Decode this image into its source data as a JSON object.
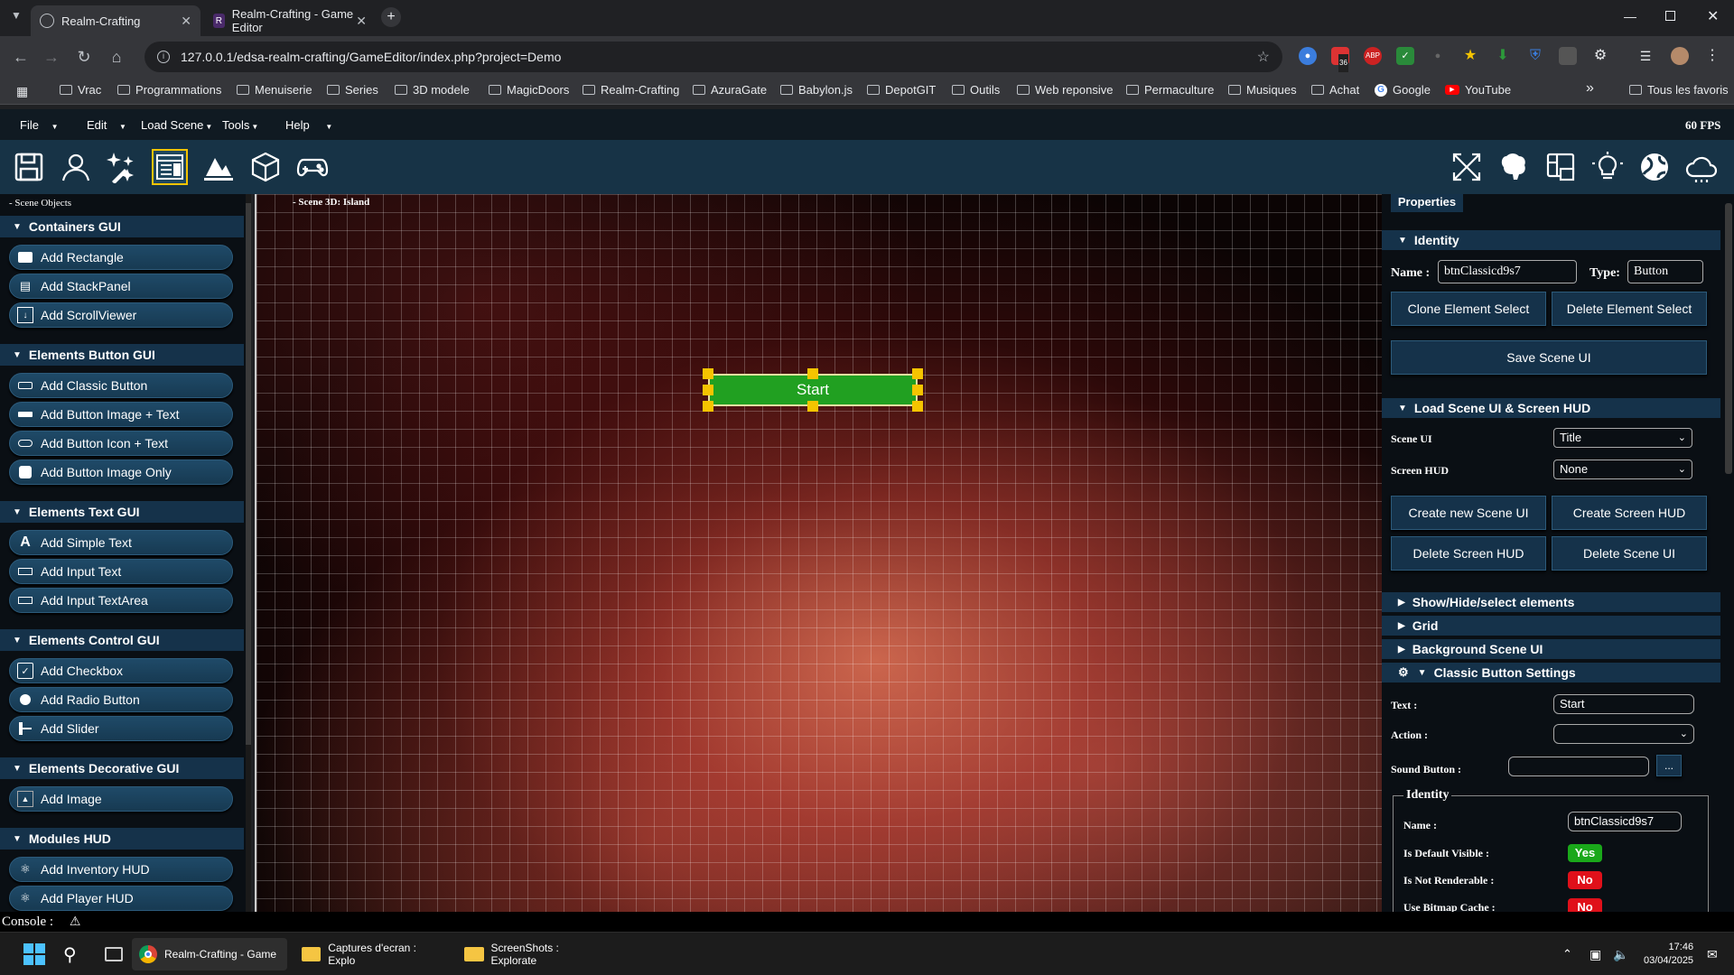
{
  "browser": {
    "tabs": [
      {
        "title": "Realm-Crafting",
        "active": true
      },
      {
        "title": "Realm-Crafting - Game Editor",
        "active": false
      }
    ],
    "url": "127.0.0.1/edsa-realm-crafting/GameEditor/index.php?project=Demo",
    "ext_badge": "36",
    "bookmarks": [
      "Vrac",
      "Programmations",
      "Menuiserie",
      "Series",
      "3D modele",
      "MagicDoors",
      "Realm-Crafting",
      "AzuraGate",
      "Babylon.js",
      "DepotGIT",
      "Outils",
      "Web reponsive",
      "Permaculture",
      "Musiques",
      "Achat",
      "Google",
      "YouTube"
    ],
    "bookmarks_more": "»",
    "all_bookmarks": "Tous les favoris"
  },
  "menubar": {
    "items": [
      "File",
      "Edit",
      "Load Scene",
      "Tools",
      "Help"
    ],
    "fps": "60 FPS"
  },
  "toolbar": {
    "left_icons": [
      "save-icon",
      "user-icon",
      "magic-stars-icon",
      "gui-editor-icon",
      "terrain-icon",
      "cube-icon",
      "gamepad-icon"
    ],
    "right_icons": [
      "fullscreen-icon",
      "brain-icon",
      "panel-layout-icon",
      "light-icon",
      "globe-icon",
      "cloud-icon"
    ]
  },
  "left_panel": {
    "header": "- Scene Objects",
    "sections": [
      {
        "title": "Containers GUI",
        "items": [
          {
            "label": "Add Rectangle",
            "icon": "rectangle-icon"
          },
          {
            "label": "Add StackPanel",
            "icon": "stackpanel-icon"
          },
          {
            "label": "Add ScrollViewer",
            "icon": "scrollviewer-icon"
          }
        ]
      },
      {
        "title": "Elements Button GUI",
        "items": [
          {
            "label": "Add Classic Button",
            "icon": "button-icon"
          },
          {
            "label": "Add Button Image + Text",
            "icon": "button-image-text-icon"
          },
          {
            "label": "Add Button Icon + Text",
            "icon": "button-icon-text-icon"
          },
          {
            "label": "Add Button Image Only",
            "icon": "button-image-icon"
          }
        ]
      },
      {
        "title": "Elements Text GUI",
        "items": [
          {
            "label": "Add Simple Text",
            "icon": "text-icon"
          },
          {
            "label": "Add Input Text",
            "icon": "input-text-icon"
          },
          {
            "label": "Add Input TextArea",
            "icon": "textarea-icon"
          }
        ]
      },
      {
        "title": "Elements Control GUI",
        "items": [
          {
            "label": "Add Checkbox",
            "icon": "checkbox-icon"
          },
          {
            "label": "Add Radio Button",
            "icon": "radio-icon"
          },
          {
            "label": "Add Slider",
            "icon": "slider-icon"
          }
        ]
      },
      {
        "title": "Elements Decorative GUI",
        "items": [
          {
            "label": "Add Image",
            "icon": "image-icon"
          }
        ]
      },
      {
        "title": "Modules HUD",
        "items": [
          {
            "label": "Add Inventory HUD",
            "icon": "inventory-icon"
          },
          {
            "label": "Add Player HUD",
            "icon": "player-hud-icon"
          }
        ]
      }
    ]
  },
  "viewport": {
    "title": "- Scene 3D: Island",
    "button_text": "Start"
  },
  "properties": {
    "tab": "Properties",
    "identity_title": "Identity",
    "name_label": "Name :",
    "name_value": "btnClassicd9s7",
    "type_label": "Type:",
    "type_value": "Button",
    "clone_btn": "Clone Element Select",
    "delete_btn": "Delete Element Select",
    "save_btn": "Save Scene UI",
    "load_title": "Load Scene UI & Screen HUD",
    "scene_ui_label": "Scene UI",
    "scene_ui_value": "Title",
    "screen_hud_label": "Screen HUD",
    "screen_hud_value": "None",
    "create_scene_ui": "Create new Scene UI",
    "create_screen_hud": "Create Screen HUD",
    "delete_screen_hud": "Delete Screen HUD",
    "delete_scene_ui": "Delete Scene UI",
    "collapsed": [
      "Show/Hide/select elements",
      "Grid",
      "Background Scene UI"
    ],
    "classic_title": "Classic Button Settings",
    "text_label": "Text :",
    "text_value": "Start",
    "action_label": "Action :",
    "action_value": "",
    "sound_label": "Sound Button :",
    "sound_value": "",
    "browse": "...",
    "sub_identity": "Identity",
    "sub_name_label": "Name :",
    "sub_name_value": "btnClassicd9s7",
    "flags": [
      {
        "label": "Is Default Visible :",
        "value": "Yes",
        "color": "#1aa81a"
      },
      {
        "label": "Is Not Renderable :",
        "value": "No",
        "color": "#e0101a"
      },
      {
        "label": "Use Bitmap Cache :",
        "value": "No",
        "color": "#e0101a"
      }
    ]
  },
  "console": {
    "label": "Console :"
  },
  "taskbar": {
    "apps": [
      "Realm-Crafting - Game",
      "Captures d'ecran : Explo",
      "ScreenShots : Explorate"
    ],
    "time": "17:46",
    "date": "03/04/2025"
  }
}
